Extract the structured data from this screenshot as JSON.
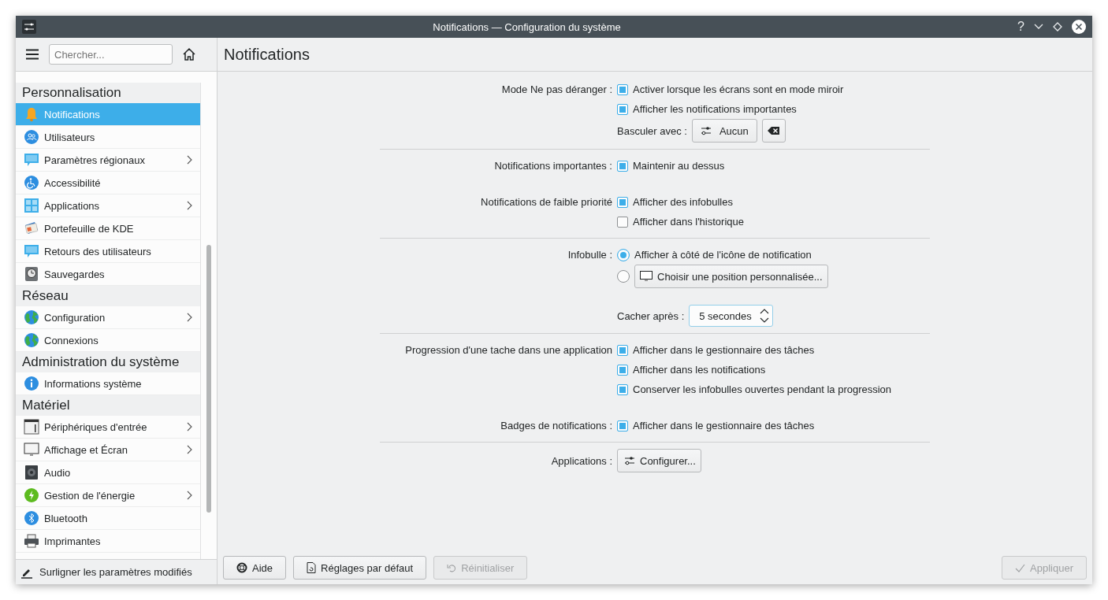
{
  "window": {
    "title": "Notifications — Configuration du système",
    "help": "?"
  },
  "sidebar": {
    "search": {
      "placeholder": "Chercher..."
    },
    "sections": [
      {
        "title": "Personnalisation",
        "items": [
          {
            "label": "Notifications",
            "has_children": false,
            "selected": true
          },
          {
            "label": "Utilisateurs",
            "has_children": false,
            "selected": false
          },
          {
            "label": "Paramètres régionaux",
            "has_children": true,
            "selected": false
          },
          {
            "label": "Accessibilité",
            "has_children": false,
            "selected": false
          },
          {
            "label": "Applications",
            "has_children": true,
            "selected": false
          },
          {
            "label": "Portefeuille de KDE",
            "has_children": false,
            "selected": false
          },
          {
            "label": "Retours des utilisateurs",
            "has_children": false,
            "selected": false
          },
          {
            "label": "Sauvegardes",
            "has_children": false,
            "selected": false
          }
        ]
      },
      {
        "title": "Réseau",
        "items": [
          {
            "label": "Configuration",
            "has_children": true,
            "selected": false
          },
          {
            "label": "Connexions",
            "has_children": false,
            "selected": false
          }
        ]
      },
      {
        "title": "Administration du système",
        "items": [
          {
            "label": "Informations système",
            "has_children": false,
            "selected": false
          }
        ]
      },
      {
        "title": "Matériel",
        "items": [
          {
            "label": "Périphériques d'entrée",
            "has_children": true,
            "selected": false
          },
          {
            "label": "Affichage et Écran",
            "has_children": true,
            "selected": false
          },
          {
            "label": "Audio",
            "has_children": false,
            "selected": false
          },
          {
            "label": "Gestion de l'énergie",
            "has_children": true,
            "selected": false
          },
          {
            "label": "Bluetooth",
            "has_children": false,
            "selected": false
          },
          {
            "label": "Imprimantes",
            "has_children": false,
            "selected": false
          }
        ]
      }
    ],
    "highlight_button": "Surligner les paramètres modifiés"
  },
  "page": {
    "title": "Notifications",
    "sections": [
      {
        "groups": [
          {
            "rows": [
              {
                "kind": "checkbox",
                "label": "Mode Ne pas déranger :",
                "text": "Activer lorsque les écrans sont en mode miroir",
                "checked": true
              },
              {
                "kind": "checkbox",
                "text": "Afficher les notifications importantes",
                "checked": true
              },
              {
                "kind": "shortcut",
                "caption": "Basculer avec :",
                "button": "Aucun"
              }
            ]
          }
        ]
      },
      {
        "groups": [
          {
            "rows": [
              {
                "kind": "checkbox",
                "label": "Notifications importantes :",
                "text": "Maintenir au dessus",
                "checked": true
              }
            ]
          },
          {
            "rows": [
              {
                "kind": "checkbox",
                "label": "Notifications de faible priorité",
                "text": "Afficher des infobulles",
                "checked": true
              },
              {
                "kind": "checkbox",
                "text": "Afficher dans l'historique",
                "checked": false
              }
            ]
          }
        ]
      },
      {
        "groups": [
          {
            "rows": [
              {
                "kind": "radio",
                "label": "Infobulle :",
                "text": "Afficher à côté de l'icône de notification",
                "selected": true
              },
              {
                "kind": "radio",
                "button": "Choisir une position personnalisée...",
                "selected": false
              }
            ]
          },
          {
            "rows": [
              {
                "kind": "spin",
                "caption": "Cacher après :",
                "value": "5 secondes"
              }
            ]
          }
        ]
      },
      {
        "groups": [
          {
            "rows": [
              {
                "kind": "checkbox",
                "label": "Progression d'une tache dans une application",
                "text": "Afficher dans le gestionnaire des tâches",
                "checked": true
              },
              {
                "kind": "checkbox",
                "text": "Afficher dans les notifications",
                "checked": true
              },
              {
                "kind": "checkbox",
                "text": "Conserver les infobulles ouvertes pendant la progression",
                "checked": true
              }
            ]
          },
          {
            "rows": [
              {
                "kind": "checkbox",
                "label": "Badges de notifications :",
                "text": "Afficher dans le gestionnaire des tâches",
                "checked": true
              }
            ]
          }
        ]
      },
      {
        "groups": [
          {
            "rows": [
              {
                "kind": "button",
                "label": "Applications :",
                "button": "Configurer..."
              }
            ]
          }
        ]
      }
    ]
  },
  "footer": {
    "buttons": [
      {
        "kind": "help",
        "label": "Aide",
        "disabled": false
      },
      {
        "kind": "defaults",
        "label": "Réglages par défaut",
        "disabled": false
      },
      {
        "kind": "reset",
        "label": "Réinitialiser",
        "disabled": true
      },
      {
        "kind": "apply",
        "label": "Appliquer",
        "disabled": true
      }
    ]
  }
}
